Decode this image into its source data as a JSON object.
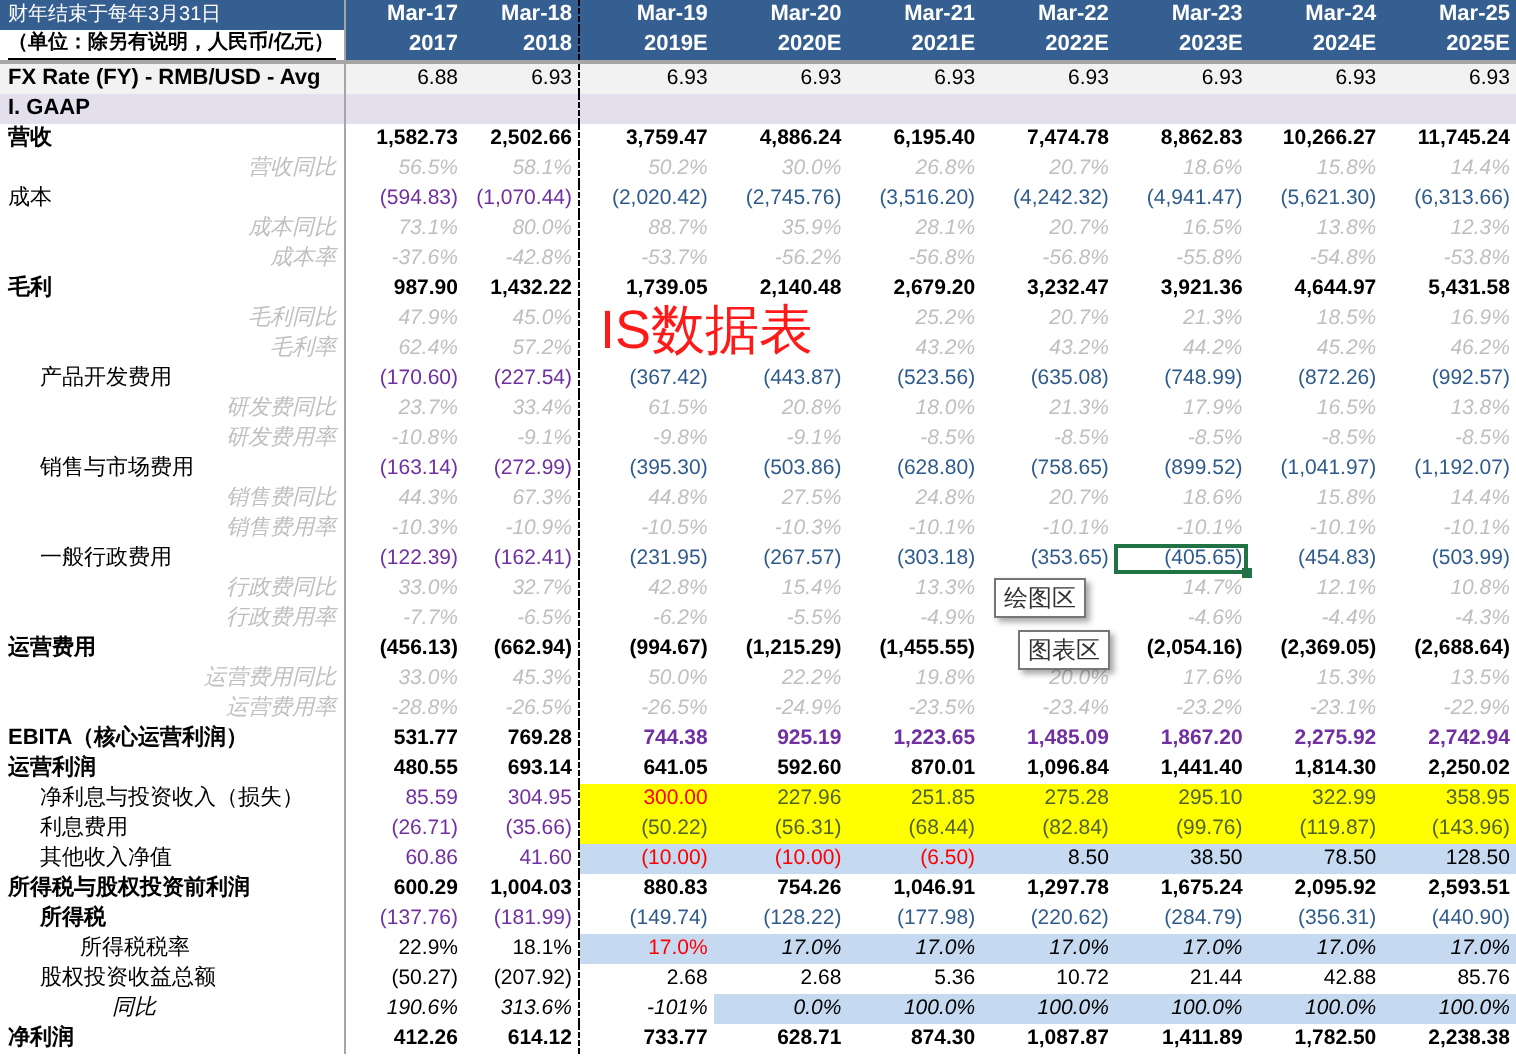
{
  "header": {
    "fiscal_note": "财年结束于每年3月31日",
    "unit_note": "（单位：除另有说明，人民币/亿元）"
  },
  "columns": [
    {
      "month": "Mar-17",
      "year": "2017",
      "actual": true
    },
    {
      "month": "Mar-18",
      "year": "2018",
      "actual": true
    },
    {
      "month": "Mar-19",
      "year": "2019E",
      "actual": false
    },
    {
      "month": "Mar-20",
      "year": "2020E",
      "actual": false
    },
    {
      "month": "Mar-21",
      "year": "2021E",
      "actual": false
    },
    {
      "month": "Mar-22",
      "year": "2022E",
      "actual": false
    },
    {
      "month": "Mar-23",
      "year": "2023E",
      "actual": false
    },
    {
      "month": "Mar-24",
      "year": "2024E",
      "actual": false
    },
    {
      "month": "Mar-25",
      "year": "2025E",
      "actual": false
    }
  ],
  "fx_row": {
    "label": "FX Rate (FY) - RMB/USD - Avg",
    "values": [
      "6.88",
      "6.93",
      "6.93",
      "6.93",
      "6.93",
      "6.93",
      "6.93",
      "6.93",
      "6.93"
    ]
  },
  "section": "I. GAAP",
  "rows": [
    {
      "label": "营收",
      "kind": "total",
      "values": [
        "1,582.73",
        "2,502.66",
        "3,759.47",
        "4,886.24",
        "6,195.40",
        "7,474.78",
        "8,862.83",
        "10,266.27",
        "11,745.24"
      ]
    },
    {
      "label": "营收同比",
      "kind": "ratio",
      "values": [
        "56.5%",
        "58.1%",
        "50.2%",
        "30.0%",
        "26.8%",
        "20.7%",
        "18.6%",
        "15.8%",
        "14.4%"
      ]
    },
    {
      "label": "成本",
      "kind": "cost",
      "values": [
        "(594.83)",
        "(1,070.44)",
        "(2,020.42)",
        "(2,745.76)",
        "(3,516.20)",
        "(4,242.32)",
        "(4,941.47)",
        "(5,621.30)",
        "(6,313.66)"
      ]
    },
    {
      "label": "成本同比",
      "kind": "ratio",
      "values": [
        "73.1%",
        "80.0%",
        "88.7%",
        "35.9%",
        "28.1%",
        "20.7%",
        "16.5%",
        "13.8%",
        "12.3%"
      ]
    },
    {
      "label": "成本率",
      "kind": "ratio",
      "values": [
        "-37.6%",
        "-42.8%",
        "-53.7%",
        "-56.2%",
        "-56.8%",
        "-56.8%",
        "-55.8%",
        "-54.8%",
        "-53.8%"
      ]
    },
    {
      "label": "毛利",
      "kind": "total",
      "values": [
        "987.90",
        "1,432.22",
        "1,739.05",
        "2,140.48",
        "2,679.20",
        "3,232.47",
        "3,921.36",
        "4,644.97",
        "5,431.58"
      ]
    },
    {
      "label": "毛利同比",
      "kind": "ratio",
      "values": [
        "47.9%",
        "45.0%",
        {
          "kind": "covered"
        },
        {
          "kind": "covered"
        },
        "25.2%",
        "20.7%",
        "21.3%",
        "18.5%",
        "16.9%"
      ]
    },
    {
      "label": "毛利率",
      "kind": "ratio",
      "values": [
        "62.4%",
        "57.2%",
        {
          "kind": "covered"
        },
        {
          "kind": "covered"
        },
        "43.2%",
        "43.2%",
        "44.2%",
        "45.2%",
        "46.2%"
      ]
    },
    {
      "label": "产品开发费用",
      "kind": "expense_item",
      "values": [
        "(170.60)",
        "(227.54)",
        "(367.42)",
        "(443.87)",
        "(523.56)",
        "(635.08)",
        "(748.99)",
        "(872.26)",
        "(992.57)"
      ]
    },
    {
      "label": "研发费同比",
      "kind": "ratio",
      "values": [
        "23.7%",
        "33.4%",
        "61.5%",
        "20.8%",
        "18.0%",
        "21.3%",
        "17.9%",
        "16.5%",
        "13.8%"
      ]
    },
    {
      "label": "研发费用率",
      "kind": "ratio",
      "values": [
        "-10.8%",
        "-9.1%",
        "-9.8%",
        "-9.1%",
        "-8.5%",
        "-8.5%",
        "-8.5%",
        "-8.5%",
        "-8.5%"
      ]
    },
    {
      "label": "销售与市场费用",
      "kind": "expense_item",
      "values": [
        "(163.14)",
        "(272.99)",
        "(395.30)",
        "(503.86)",
        "(628.80)",
        "(758.65)",
        "(899.52)",
        "(1,041.97)",
        "(1,192.07)"
      ]
    },
    {
      "label": "销售费同比",
      "kind": "ratio",
      "values": [
        "44.3%",
        "67.3%",
        "44.8%",
        "27.5%",
        "24.8%",
        "20.7%",
        "18.6%",
        "15.8%",
        "14.4%"
      ]
    },
    {
      "label": "销售费用率",
      "kind": "ratio",
      "values": [
        "-10.3%",
        "-10.9%",
        "-10.5%",
        "-10.3%",
        "-10.1%",
        "-10.1%",
        "-10.1%",
        "-10.1%",
        "-10.1%"
      ]
    },
    {
      "label": "一般行政费用",
      "kind": "expense_item",
      "values": [
        "(122.39)",
        "(162.41)",
        "(231.95)",
        "(267.57)",
        "(303.18)",
        "(353.65)",
        "(405.65)",
        "(454.83)",
        "(503.99)"
      ],
      "selected": [
        false,
        false,
        false,
        false,
        false,
        false,
        true,
        false,
        false
      ]
    },
    {
      "label": "行政费同比",
      "kind": "ratio",
      "values": [
        "33.0%",
        "32.7%",
        "42.8%",
        "15.4%",
        "13.3%",
        {
          "kind": "covered"
        },
        "14.7%",
        "12.1%",
        "10.8%"
      ]
    },
    {
      "label": "行政费用率",
      "kind": "ratio",
      "values": [
        "-7.7%",
        "-6.5%",
        "-6.2%",
        "-5.5%",
        "-4.9%",
        {
          "kind": "covered"
        },
        "-4.6%",
        "-4.4%",
        "-4.3%"
      ]
    },
    {
      "label": "运营费用",
      "kind": "total",
      "values": [
        "(456.13)",
        "(662.94)",
        "(994.67)",
        "(1,215.29)",
        "(1,455.55)",
        {
          "kind": "covered"
        },
        "(2,054.16)",
        "(2,369.05)",
        "(2,688.64)"
      ]
    },
    {
      "label": "运营费用同比",
      "kind": "ratio",
      "values": [
        "33.0%",
        "45.3%",
        "50.0%",
        "22.2%",
        "19.8%",
        "20.0%",
        "17.6%",
        "15.3%",
        "13.5%"
      ]
    },
    {
      "label": "运营费用率",
      "kind": "ratio",
      "values": [
        "-28.8%",
        "-26.5%",
        "-26.5%",
        "-24.9%",
        "-23.5%",
        "-23.4%",
        "-23.2%",
        "-23.1%",
        "-22.9%"
      ]
    },
    {
      "label": "EBITA（核心运营利润）",
      "kind": "margin_total",
      "values": [
        "531.77",
        "769.28",
        "744.38",
        "925.19",
        "1,223.65",
        "1,485.09",
        "1,867.20",
        "2,275.92",
        "2,742.94"
      ]
    },
    {
      "label": "运营利润",
      "kind": "total",
      "values": [
        "480.55",
        "693.14",
        "641.05",
        "592.60",
        "870.01",
        "1,096.84",
        "1,441.40",
        "1,814.30",
        "2,250.02"
      ]
    },
    {
      "label": "净利息与投资收入（损失）",
      "kind": "income_item",
      "values": [
        "85.59",
        "304.95",
        "300.00",
        "227.96",
        "251.85",
        "275.28",
        "295.10",
        "322.99",
        "358.95"
      ],
      "shaded": [
        false,
        false,
        true,
        true,
        true,
        true,
        true,
        true,
        true
      ],
      "alerts": [
        false,
        false,
        true,
        false,
        false,
        false,
        false,
        false,
        false
      ]
    },
    {
      "label": "利息费用",
      "kind": "income_item",
      "values": [
        "(26.71)",
        "(35.66)",
        "(50.22)",
        "(56.31)",
        "(68.44)",
        "(82.84)",
        "(99.76)",
        "(119.87)",
        "(143.96)"
      ],
      "shaded": [
        false,
        false,
        true,
        true,
        true,
        true,
        true,
        true,
        true
      ]
    },
    {
      "label": "其他收入净值",
      "kind": "other_item",
      "values": [
        "60.86",
        "41.60",
        "(10.00)",
        "(10.00)",
        "(6.50)",
        "8.50",
        "38.50",
        "78.50",
        "128.50"
      ],
      "shaded": [
        false,
        false,
        true,
        true,
        true,
        true,
        true,
        true,
        true
      ],
      "alerts": [
        false,
        false,
        true,
        true,
        true,
        false,
        false,
        false,
        false
      ]
    },
    {
      "label": "所得税与股权投资前利润",
      "kind": "total",
      "values": [
        "600.29",
        "1,004.03",
        "880.83",
        "754.26",
        "1,046.91",
        "1,297.78",
        "1,675.24",
        "2,095.92",
        "2,593.51"
      ]
    },
    {
      "label": "所得税",
      "kind": "tax_item",
      "values": [
        "(137.76)",
        "(181.99)",
        "(149.74)",
        "(128.22)",
        "(177.98)",
        "(220.62)",
        "(284.79)",
        "(356.31)",
        "(440.90)"
      ]
    },
    {
      "label": "所得税税率",
      "kind": "tax_rate",
      "values": [
        "22.9%",
        "18.1%",
        "17.0%",
        "17.0%",
        "17.0%",
        "17.0%",
        "17.0%",
        "17.0%",
        "17.0%"
      ],
      "shaded": [
        false,
        false,
        true,
        true,
        true,
        true,
        true,
        true,
        true
      ],
      "alerts": [
        false,
        false,
        true,
        false,
        false,
        false,
        false,
        false,
        false
      ]
    },
    {
      "label": "股权投资收益总额",
      "kind": "equity_item",
      "values": [
        "(50.27)",
        "(207.92)",
        "2.68",
        "2.68",
        "5.36",
        "10.72",
        "21.44",
        "42.88",
        "85.76"
      ]
    },
    {
      "label": "同比",
      "kind": "yoy_inline",
      "values": [
        "190.6%",
        "313.6%",
        "-101%",
        "0.0%",
        "100.0%",
        "100.0%",
        "100.0%",
        "100.0%",
        "100.0%"
      ],
      "shaded": [
        false,
        false,
        false,
        true,
        true,
        true,
        true,
        true,
        true
      ]
    },
    {
      "label": "净利润",
      "kind": "total",
      "values": [
        "412.26",
        "614.12",
        "733.77",
        "628.71",
        "874.30",
        "1,087.87",
        "1,411.89",
        "1,782.50",
        "2,238.38"
      ]
    }
  ],
  "overlay_title": "IS数据表",
  "tooltips": [
    "绘图区",
    "图表区"
  ]
}
